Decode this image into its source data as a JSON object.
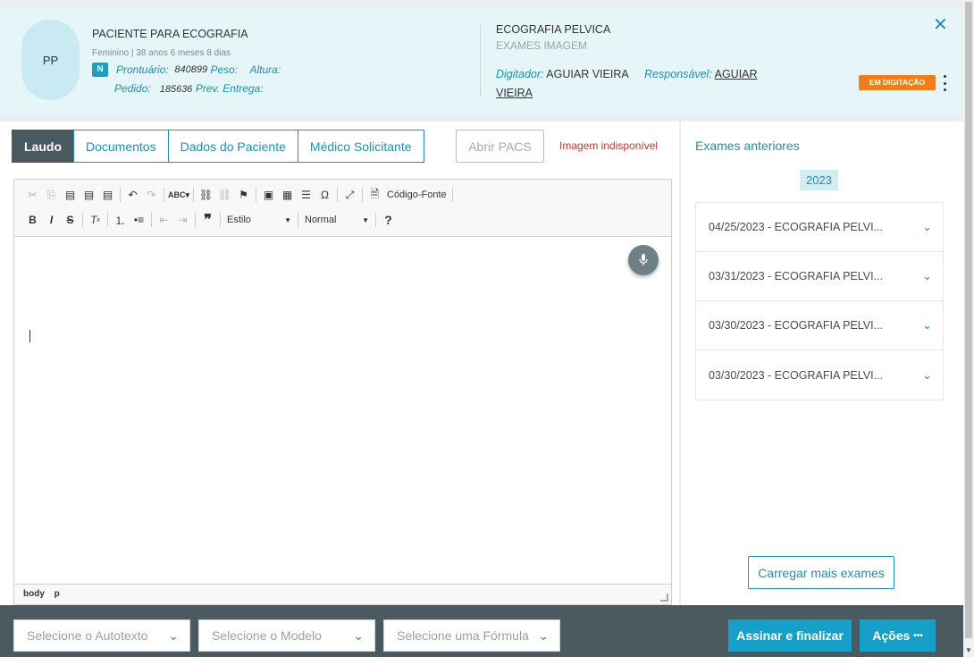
{
  "header": {
    "avatar_initials": "PP",
    "patient_name": "PACIENTE PARA ECOGRAFIA",
    "patient_meta": "Feminino | 38 anos 6 meses 8 dias",
    "badge": "N",
    "prontuario_label": "Prontuário:",
    "prontuario_value": "840899",
    "peso_label": "Peso:",
    "altura_label": "Altura:",
    "pedido_label": "Pedido:",
    "pedido_value": "185636",
    "entrega_label": "Prev. Entrega:",
    "exam_title": "ECOGRAFIA PELVICA",
    "exam_subtitle": "EXAMES IMAGEM",
    "digitador_label": "Digitador:",
    "digitador_value": "AGUIAR VIEIRA",
    "responsavel_label": "Responsável:",
    "responsavel_value_1": "AGUIAR",
    "responsavel_value_2": "VIEIRA",
    "status": "EM DIGITAÇÃO",
    "close_glyph": "✕"
  },
  "tabs": [
    "Laudo",
    "Documentos",
    "Dados do Paciente",
    "Médico Solicitante"
  ],
  "pacs_button": "Abrir PACS",
  "image_status": "Imagem indisponível",
  "editor": {
    "toolbar_row1": [
      "✂",
      "⎘",
      "📋",
      "📋",
      "📋",
      "|",
      "↶",
      "↷",
      "|",
      "ABC▾",
      "|",
      "🔗",
      "⛓",
      "⚑",
      "|",
      "🖼",
      "▦",
      "☰",
      "Ω",
      "|",
      "⛶",
      "|",
      "🗎",
      "Código-Fonte",
      "|"
    ],
    "source_label": "Código-Fonte",
    "style_combo": "Estilo",
    "format_combo": "Normal",
    "status_tags": [
      "body",
      "p"
    ]
  },
  "side": {
    "title": "Exames anteriores",
    "year": "2023",
    "exams": [
      "04/25/2023 - ECOGRAFIA PELVI...",
      "03/31/2023 - ECOGRAFIA PELVI...",
      "03/30/2023 - ECOGRAFIA PELVI...",
      "03/30/2023 - ECOGRAFIA PELVI..."
    ],
    "load_more": "Carregar mais exames"
  },
  "footer": {
    "autotexto_placeholder": "Selecione o Autotexto",
    "modelo_placeholder": "Selecione o Modelo",
    "formula_placeholder": "Selecione uma Fórmula",
    "sign_button": "Assinar e finalizar",
    "actions_button": "Ações",
    "actions_glyph": "•••"
  },
  "colors": {
    "accent": "#1f8fb0",
    "header_bg": "#e6f5f8",
    "status_orange": "#ef7d1a",
    "footer_bg": "#4b5a61",
    "primary_button": "#16a0c8"
  },
  "icons": {
    "microphone": "mic-icon",
    "chevron": "chevron-down-icon",
    "close": "close-icon"
  }
}
